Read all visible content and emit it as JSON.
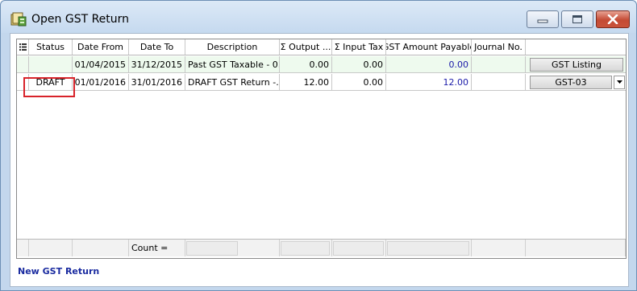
{
  "window": {
    "title": "Open GST Return"
  },
  "grid": {
    "columns": [
      "Status",
      "Date From",
      "Date To",
      "Description",
      "Σ Output ...",
      "Σ Input Tax",
      "GST Amount Payable",
      "Journal No."
    ],
    "rows": [
      {
        "status": "",
        "date_from": "01/04/2015",
        "date_to": "31/12/2015",
        "description": "Past GST Taxable - 0...",
        "output": "0.00",
        "input_tax": "0.00",
        "payable": "0.00",
        "journal_no": "",
        "action": "GST Listing"
      },
      {
        "status": "DRAFT",
        "date_from": "01/01/2016",
        "date_to": "31/01/2016",
        "description": "DRAFT GST Return -...",
        "output": "12.00",
        "input_tax": "0.00",
        "payable": "12.00",
        "journal_no": "",
        "action": "GST-03"
      }
    ],
    "footer": {
      "count_label": "Count ="
    }
  },
  "links": {
    "new_gst_return": "New GST Return"
  },
  "colors": {
    "highlight_box": "#d8232a",
    "row_shade": "#eefaee",
    "amount_blue": "#1a1aa8",
    "link": "#1a2ba0"
  }
}
